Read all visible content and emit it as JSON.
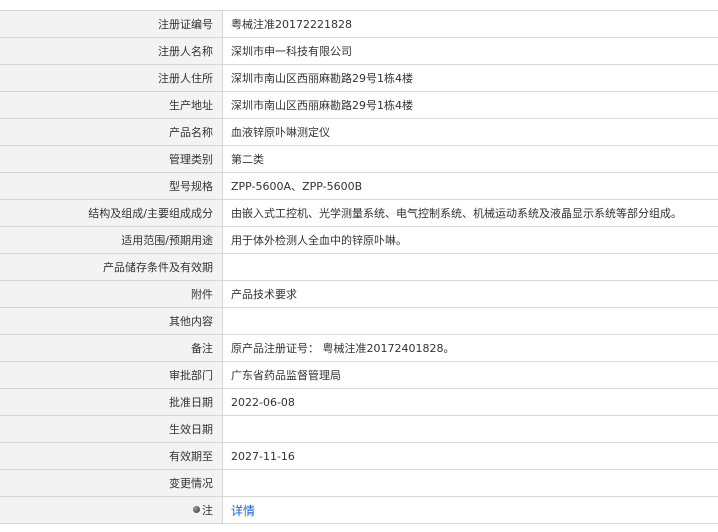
{
  "rows": [
    {
      "label": "注册证编号",
      "value": "粤械注准20172221828"
    },
    {
      "label": "注册人名称",
      "value": "深圳市申一科技有限公司"
    },
    {
      "label": "注册人住所",
      "value": "深圳市南山区西丽麻勘路29号1栋4楼"
    },
    {
      "label": "生产地址",
      "value": "深圳市南山区西丽麻勘路29号1栋4楼"
    },
    {
      "label": "产品名称",
      "value": "血液锌原卟啉测定仪"
    },
    {
      "label": "管理类别",
      "value": "第二类"
    },
    {
      "label": "型号规格",
      "value": "ZPP-5600A、ZPP-5600B"
    },
    {
      "label": "结构及组成/主要组成成分",
      "value": "由嵌入式工控机、光学测量系统、电气控制系统、机械运动系统及液晶显示系统等部分组成。"
    },
    {
      "label": "适用范围/预期用途",
      "value": "用于体外检测人全血中的锌原卟啉。"
    },
    {
      "label": "产品储存条件及有效期",
      "value": ""
    },
    {
      "label": "附件",
      "value": "产品技术要求"
    },
    {
      "label": "其他内容",
      "value": ""
    },
    {
      "label": "备注",
      "value": "原产品注册证号： 粤械注准20172401828。"
    },
    {
      "label": "审批部门",
      "value": "广东省药品监督管理局"
    },
    {
      "label": "批准日期",
      "value": "2022-06-08"
    },
    {
      "label": "生效日期",
      "value": ""
    },
    {
      "label": "有效期至",
      "value": "2027-11-16"
    },
    {
      "label": "变更情况",
      "value": ""
    }
  ],
  "note": {
    "label": "注",
    "icon": "pin-icon",
    "link_text": "详情"
  }
}
